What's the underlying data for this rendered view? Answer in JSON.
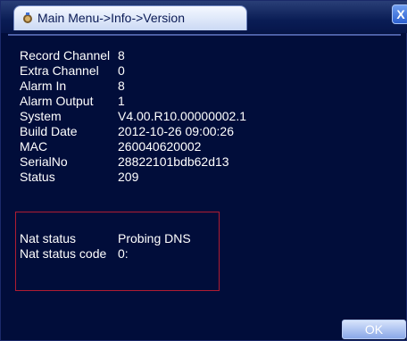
{
  "window": {
    "title": "Main Menu->Info->Version",
    "close_label": "X"
  },
  "info": [
    {
      "label": "Record Channel",
      "value": "8"
    },
    {
      "label": "Extra Channel",
      "value": "0"
    },
    {
      "label": "Alarm In",
      "value": "8"
    },
    {
      "label": "Alarm Output",
      "value": "1"
    },
    {
      "label": "System",
      "value": "V4.00.R10.00000002.1"
    },
    {
      "label": "Build Date",
      "value": "2012-10-26 09:00:26"
    },
    {
      "label": "MAC",
      "value": "260040620002"
    },
    {
      "label": "SerialNo",
      "value": "28822101bdb62d13"
    },
    {
      "label": "Status",
      "value": "209"
    }
  ],
  "nat": [
    {
      "label": "Nat status",
      "value": "Probing DNS"
    },
    {
      "label": "Nat status code",
      "value": "0:"
    }
  ],
  "footer": {
    "ok_label": "OK"
  },
  "colors": {
    "background": "#010d3a",
    "text": "#ffffff",
    "nat_box_border": "#b01c32",
    "title_text": "#0a1a55"
  }
}
